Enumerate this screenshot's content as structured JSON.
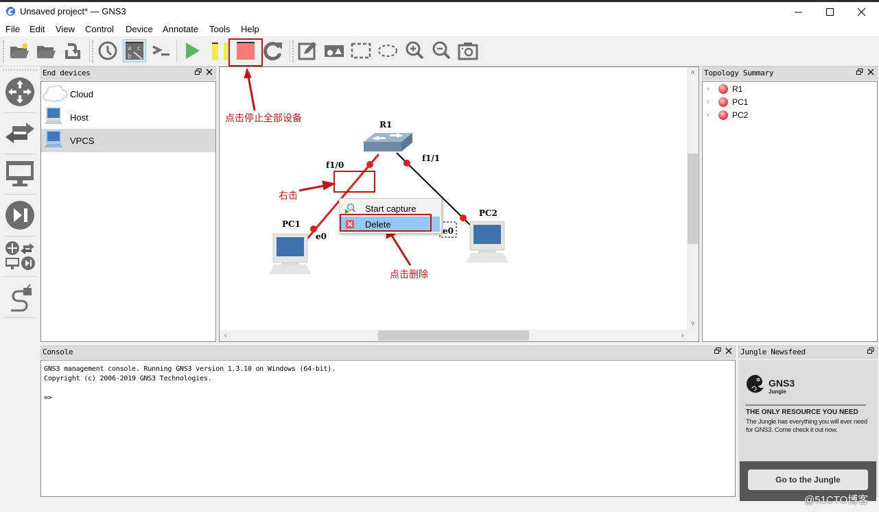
{
  "window": {
    "title": "Unsaved project* — GNS3",
    "controls": {
      "minimize": "minimize",
      "maximize": "maximize",
      "close": "close"
    }
  },
  "menubar": {
    "items": [
      "File",
      "Edit",
      "View",
      "Control",
      "Device",
      "Annotate",
      "Tools",
      "Help"
    ]
  },
  "toolbar": {
    "buttons": [
      {
        "name": "new-project",
        "icon": "folder-new-icon"
      },
      {
        "name": "open-project",
        "icon": "folder-open-icon"
      },
      {
        "name": "save-project",
        "icon": "save-icon"
      },
      {
        "name": "snapshot",
        "icon": "clock-icon"
      },
      {
        "name": "show-interface-labels",
        "icon": "interface-labels-icon",
        "checked": true
      },
      {
        "name": "console-all",
        "icon": "terminal-icon"
      },
      {
        "name": "start-all",
        "icon": "play-icon"
      },
      {
        "name": "suspend-all",
        "icon": "pause-icon"
      },
      {
        "name": "stop-all",
        "icon": "stop-icon"
      },
      {
        "name": "reload-all",
        "icon": "reload-icon"
      },
      {
        "name": "add-note",
        "icon": "note-edit-icon"
      },
      {
        "name": "insert-image",
        "icon": "image-icon"
      },
      {
        "name": "draw-rectangle",
        "icon": "rectangle-icon"
      },
      {
        "name": "draw-ellipse",
        "icon": "ellipse-icon"
      },
      {
        "name": "zoom-in",
        "icon": "zoom-in-icon"
      },
      {
        "name": "zoom-out",
        "icon": "zoom-out-icon"
      },
      {
        "name": "screenshot",
        "icon": "camera-icon"
      }
    ]
  },
  "device_bar": {
    "buttons": [
      {
        "name": "routers",
        "icon": "router-icon"
      },
      {
        "name": "switches",
        "icon": "switch-icon"
      },
      {
        "name": "end-devices",
        "icon": "monitor-icon"
      },
      {
        "name": "security-devices",
        "icon": "security-icon"
      },
      {
        "name": "all-devices",
        "icon": "all-devices-icon"
      },
      {
        "name": "add-link",
        "icon": "cable-icon"
      }
    ]
  },
  "end_devices": {
    "title": "End devices",
    "items": [
      {
        "label": "Cloud",
        "icon": "cloud-icon",
        "selected": false
      },
      {
        "label": "Host",
        "icon": "computer-icon",
        "selected": false
      },
      {
        "label": "VPCS",
        "icon": "computer-icon",
        "selected": true
      }
    ]
  },
  "topology": {
    "nodes": [
      {
        "id": "R1",
        "label": "R1",
        "type": "switch"
      },
      {
        "id": "PC1",
        "label": "PC1",
        "type": "computer"
      },
      {
        "id": "PC2",
        "label": "PC2",
        "type": "computer"
      }
    ],
    "links": [
      {
        "from": "R1",
        "from_port": "f1/0",
        "to": "PC1",
        "to_port": "e0",
        "selected": true,
        "color": "#e02020"
      },
      {
        "from": "R1",
        "from_port": "f1/1",
        "to": "PC2",
        "to_port": "e0",
        "selected": false,
        "color": "#000000"
      }
    ],
    "port_labels": {
      "r1_f10": "f1/0",
      "r1_f11": "f1/1",
      "pc1_e0": "e0",
      "pc2_e0": "e0"
    },
    "status_color": "#e02020"
  },
  "context_menu": {
    "items": [
      {
        "label": "Start capture",
        "icon": "capture-icon",
        "highlighted": false
      },
      {
        "label": "Delete",
        "icon": "delete-icon",
        "highlighted": true
      }
    ]
  },
  "annotations": {
    "stop_all": "点击停止全部设备",
    "right_click": "右击",
    "click_delete": "点击删除",
    "color": "#c0161b"
  },
  "topology_summary": {
    "title": "Topology Summary",
    "items": [
      {
        "label": "R1",
        "status": "stopped"
      },
      {
        "label": "PC1",
        "status": "stopped"
      },
      {
        "label": "PC2",
        "status": "stopped"
      }
    ]
  },
  "console": {
    "title": "Console",
    "lines": [
      "GNS3 management console. Running GNS3 version 1.3.10 on Windows (64-bit).",
      "Copyright (c) 2006-2019 GNS3 Technologies.",
      "",
      "=>"
    ]
  },
  "jungle": {
    "title": "Jungle Newsfeed",
    "logo_main": "GNS3",
    "logo_sub": "Jungle",
    "headline": "THE ONLY RESOURCE YOU NEED",
    "body": "The Jungle has everything you will ever need for GNS3. Come check it out now.",
    "button": "Go to the Jungle"
  },
  "watermark": "@51CTO博客"
}
